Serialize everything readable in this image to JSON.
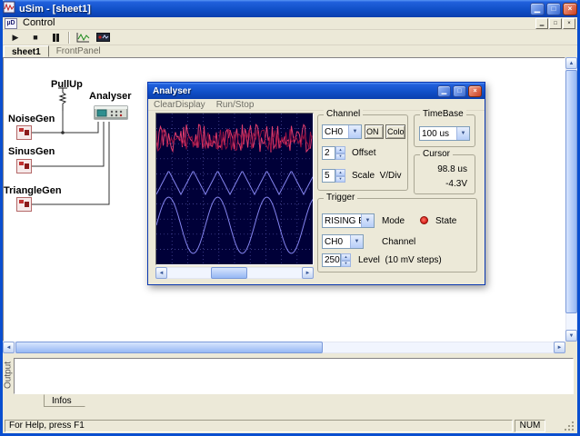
{
  "glyphs": {
    "minimize": "▁",
    "maximize": "□",
    "close": "×",
    "mdi_minimize": "▁",
    "mdi_restore": "□",
    "mdi_close": "×",
    "play": "▶",
    "stop": "■",
    "combo_arrow": "▼",
    "spin_up": "▲",
    "spin_down": "▼",
    "scroll_up": "▲",
    "scroll_down": "▼",
    "scroll_left": "◄",
    "scroll_right": "►"
  },
  "window": {
    "title": "uSim - [sheet1]"
  },
  "menubar": {
    "child_icon": "µD",
    "items": [
      {
        "label": "Control"
      }
    ]
  },
  "tabs": [
    {
      "label": "sheet1"
    },
    {
      "label": "FrontPanel"
    }
  ],
  "canvas": {
    "components": [
      {
        "label": "PullUp"
      },
      {
        "label": "Analyser"
      },
      {
        "label": "NoiseGen"
      },
      {
        "label": "SinusGen"
      },
      {
        "label": "TriangleGen"
      }
    ]
  },
  "analyser": {
    "title": "Analyser",
    "menu": [
      "ClearDisplay",
      "Run/Stop"
    ],
    "channel": {
      "legend": "Channel",
      "value": "CH0",
      "on_label": "ON",
      "color_label": "Color",
      "offset_value": "2",
      "offset_label": "Offset",
      "scale_value": "5",
      "scale_label": "Scale  V/Div"
    },
    "timebase": {
      "legend": "TimeBase",
      "value": "100 us"
    },
    "cursor": {
      "legend": "Cursor",
      "time": "98.8 us",
      "voltage": "-4.3V"
    },
    "trigger": {
      "legend": "Trigger",
      "mode_value": "RISING E",
      "mode_label": "Mode",
      "state_label": "State",
      "channel_value": "CH0",
      "channel_label": "Channel",
      "level_value": "250",
      "level_label": "Level  (10 mV steps)"
    }
  },
  "scope": {
    "background": "#000038",
    "grid_color": "#5353a8",
    "width": 172,
    "height": 166,
    "traces": [
      {
        "name": "noise-bright",
        "type": "noise",
        "color": "#e23d6d",
        "center": 27,
        "amplitude": 16,
        "seed": 11
      },
      {
        "name": "noise-dark",
        "type": "noise",
        "color": "#8f1040",
        "center": 29,
        "amplitude": 12,
        "seed": 47
      },
      {
        "name": "triangle",
        "type": "triangle",
        "color": "#8585f0",
        "center": 76,
        "amplitude": 13,
        "period": 27
      },
      {
        "name": "sine",
        "type": "sine",
        "color": "#8585f0",
        "center": 123,
        "amplitude": 31,
        "period": 54
      }
    ]
  },
  "output": {
    "label": "Output",
    "tab": "Infos"
  },
  "statusbar": {
    "help": "For Help, press F1",
    "num": "NUM"
  }
}
